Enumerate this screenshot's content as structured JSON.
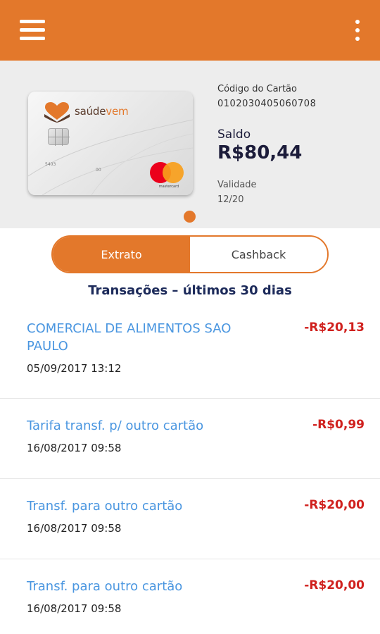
{
  "appbar": {
    "menu_icon": "hamburger-menu-icon",
    "more_icon": "more-vertical-icon",
    "color": "#e3782b"
  },
  "card": {
    "brand_part1": "saúde",
    "brand_part2": "vem",
    "number_left": "5403",
    "number_right": "00",
    "network": "mastercard",
    "code_label": "Código do Cartão",
    "code_value": "0102030405060708",
    "balance_label": "Saldo",
    "balance_value": "R$80,44",
    "validity_label": "Validade",
    "validity_value": "12/20"
  },
  "tabs": {
    "statement": "Extrato",
    "cashback": "Cashback",
    "active": "Extrato"
  },
  "section_title": "Transações – últimos 30 dias",
  "transactions": [
    {
      "description": "COMERCIAL DE ALIMENTOS SAO PAULO",
      "date": "05/09/2017 13:12",
      "amount": "-R$20,13"
    },
    {
      "description": "Tarifa transf. p/ outro cartão",
      "date": "16/08/2017 09:58",
      "amount": "-R$0,99"
    },
    {
      "description": "Transf. para outro cartão",
      "date": "16/08/2017 09:58",
      "amount": "-R$20,00"
    },
    {
      "description": "Transf. para outro cartão",
      "date": "16/08/2017 09:58",
      "amount": "-R$20,00"
    }
  ],
  "colors": {
    "accent": "#e3782b",
    "link": "#4a96e0",
    "negative": "#d0211e",
    "title": "#1c2a5a"
  }
}
